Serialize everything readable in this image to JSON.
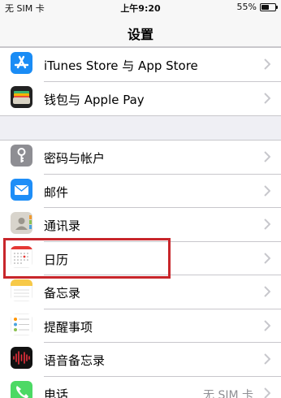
{
  "status_bar": {
    "carrier": "无 SIM 卡",
    "time": "上午9:20",
    "battery_percent": "55%",
    "battery_level": 0.55
  },
  "nav": {
    "title": "设置"
  },
  "group1": {
    "items": [
      {
        "label": "iTunes Store 与 App Store",
        "icon": "app-store-icon"
      },
      {
        "label": "钱包与 Apple Pay",
        "icon": "wallet-icon"
      }
    ]
  },
  "group2": {
    "items": [
      {
        "label": "密码与帐户",
        "icon": "key-icon"
      },
      {
        "label": "邮件",
        "icon": "mail-icon"
      },
      {
        "label": "通讯录",
        "icon": "contacts-icon"
      },
      {
        "label": "日历",
        "icon": "calendar-icon",
        "highlighted": true
      },
      {
        "label": "备忘录",
        "icon": "notes-icon"
      },
      {
        "label": "提醒事项",
        "icon": "reminders-icon"
      },
      {
        "label": "语音备忘录",
        "icon": "voice-memos-icon"
      },
      {
        "label": "电话",
        "detail": "无 SIM 卡",
        "icon": "phone-icon"
      }
    ]
  },
  "colors": {
    "background": "#efeff4",
    "highlight_border": "#c8262b",
    "app_store_blue": "#1a8cf5",
    "mail_blue": "#1e8ef7",
    "voice_memos_red": "#e9303c",
    "phone_green": "#4cd964"
  }
}
